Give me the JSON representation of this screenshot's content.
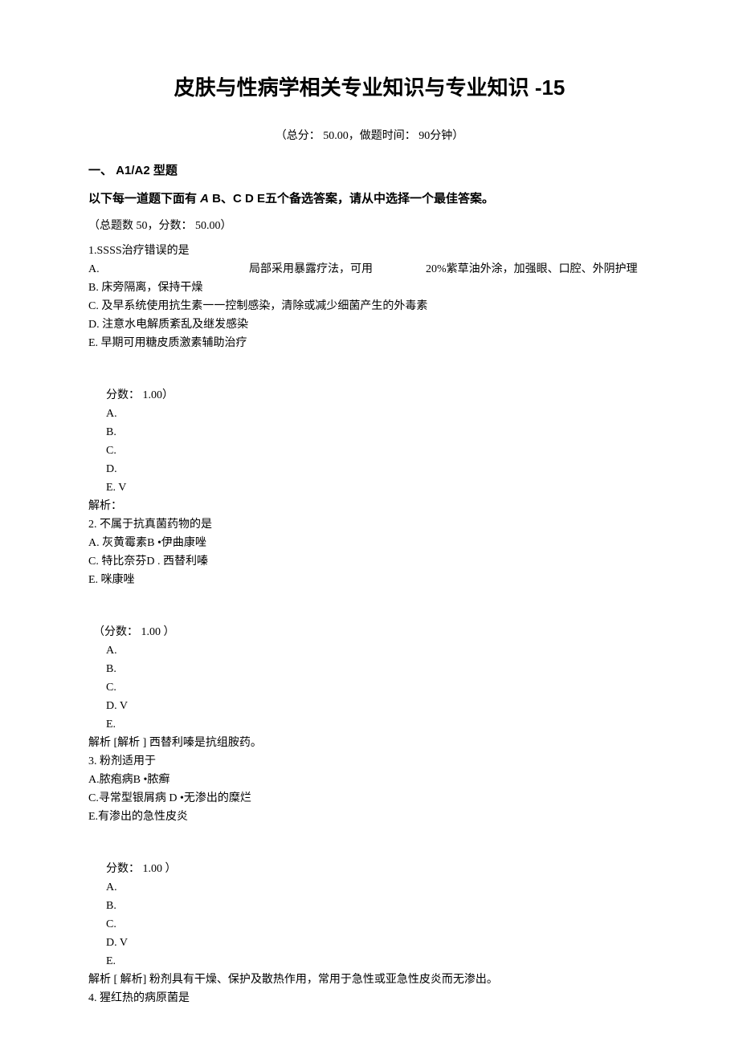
{
  "title": "皮肤与性病学相关专业知识与专业知识  -15",
  "meta": "（总分：  50.00，做题时间：  90分钟）",
  "section": "一、  A1/A2 型题",
  "instruction_pre": "以下每一道题下面有 ",
  "instruction_ital": "A",
  "instruction_post": " B、C D E五个备选答案，请从中选择一个最佳答案。",
  "count": "（总题数  50，分数：  50.00）",
  "q1": {
    "stem": "1.SSSS治疗错误的是",
    "A_label": "A.",
    "A_text": "局部采用暴露疗法，可用",
    "A_tail": "20%紫草油外涂，加强眼、口腔、外阴护理",
    "B": "B.  床旁隔离，保持干燥",
    "C": "C.  及早系统使用抗生素一一控制感染，清除或减少细菌产生的外毒素",
    "D": "D.  注意水电解质紊乱及继发感染",
    "E": "E.  早期可用糖皮质激素辅助治疗",
    "score": "分数：  1.00）",
    "ansA": "A.",
    "ansB": "B.",
    "ansC": "C.",
    "ansD": "D.",
    "ansE": "E.    V",
    "ana": "解析："
  },
  "q2": {
    "stem": "2. 不属于抗真菌药物的是",
    "A": "A.      灰黄霉素B •伊曲康唑",
    "C": "C.      特比奈芬D . 西替利嗪",
    "E": "E.      咪康唑",
    "score": "（分数：  1.00 ）",
    "ansA": "A.",
    "ansB": "B.",
    "ansC": "C.",
    "ansD": "D.   V",
    "ansE": "E.",
    "ana": "解析   [解析  ] 西替利嗪是抗组胺药。"
  },
  "q3": {
    "stem": "3. 粉剂适用于",
    "A": "A.脓疱病B •脓癣",
    "C": "C.寻常型银屑病     D •无渗出的糜烂",
    "E": "E.有渗出的急性皮炎",
    "score": "分数：  1.00 ）",
    "ansA": "A.",
    "ansB": "B.",
    "ansC": "C.",
    "ansD": "D.    V",
    "ansE": "E.",
    "ana": " 解析 [ 解析] 粉剂具有干燥、保护及散热作用，常用于急性或亚急性皮炎而无渗出。"
  },
  "q4": {
    "stem": "4.  猩红热的病原菌是"
  }
}
